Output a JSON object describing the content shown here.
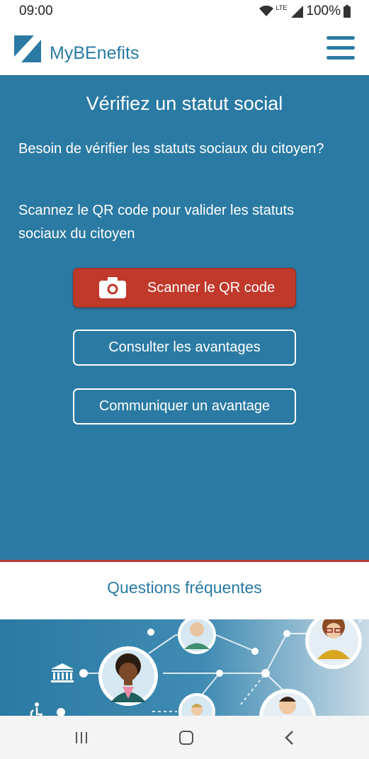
{
  "status_bar": {
    "time": "09:00",
    "network": "LTE",
    "battery": "100%"
  },
  "header": {
    "app_name": "MyBEnefits"
  },
  "hero": {
    "title": "Vérifiez un statut social",
    "paragraph1": "Besoin de vérifier les statuts sociaux du citoyen?",
    "paragraph2": "Scannez le QR code pour valider les statuts sociaux du citoyen"
  },
  "buttons": {
    "scan": "Scanner le QR code",
    "consult": "Consulter les avantages",
    "communicate": "Communiquer un avantage"
  },
  "faq": {
    "label": "Questions fréquentes"
  },
  "colors": {
    "primary": "#2a7aa3",
    "scan_button": "#c0392b",
    "faq_border": "#b83a32"
  }
}
